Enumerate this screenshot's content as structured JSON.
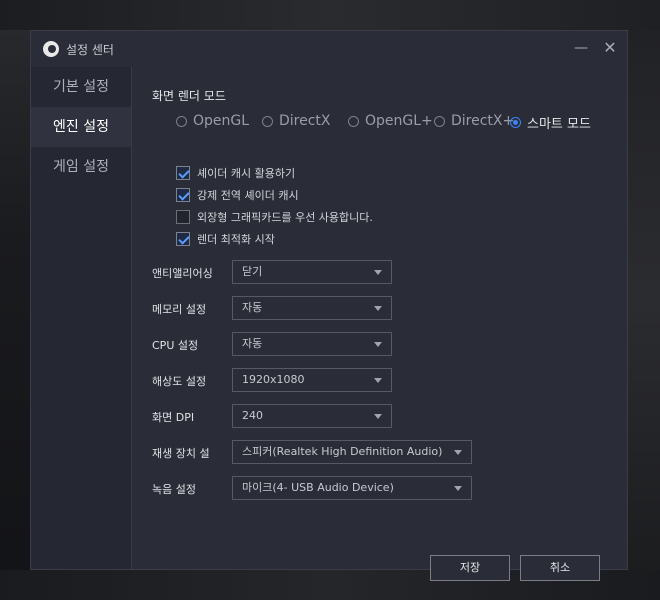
{
  "window": {
    "title": "설정 센터"
  },
  "sidebar": {
    "items": [
      {
        "label": "기본 설정",
        "active": false
      },
      {
        "label": "엔진 설정",
        "active": true
      },
      {
        "label": "게임 설정",
        "active": false
      }
    ]
  },
  "render": {
    "title": "화면 렌더 모드",
    "options": [
      "OpenGL",
      "DirectX",
      "OpenGL+",
      "DirectX+",
      "스마트 모드"
    ],
    "selected": "스마트 모드",
    "checks": [
      {
        "label": "셰이더 캐시 활용하기",
        "checked": true
      },
      {
        "label": "강제 전역 셰이더 캐시",
        "checked": true
      },
      {
        "label": "외장형 그래픽카드를 우선 사용합니다.",
        "checked": false
      },
      {
        "label": "렌더 최적화 시작",
        "checked": true
      }
    ]
  },
  "fields": [
    {
      "label": "앤티앨리어싱",
      "value": "닫기"
    },
    {
      "label": "메모리 설정",
      "value": "자동"
    },
    {
      "label": "CPU 설정",
      "value": "자동"
    },
    {
      "label": "해상도 설정",
      "value": "1920x1080"
    },
    {
      "label": "화면 DPI",
      "value": "240"
    },
    {
      "label": "재생 장치 설",
      "value": "스피커(Realtek High Definition Audio)"
    },
    {
      "label": "녹음 설정",
      "value": "마이크(4- USB Audio Device)"
    }
  ],
  "buttons": {
    "save": "저장",
    "cancel": "취소"
  },
  "colors": {
    "accent": "#3b82f6",
    "window_bg": "#2a2c37",
    "sidebar_bg": "#252733"
  }
}
